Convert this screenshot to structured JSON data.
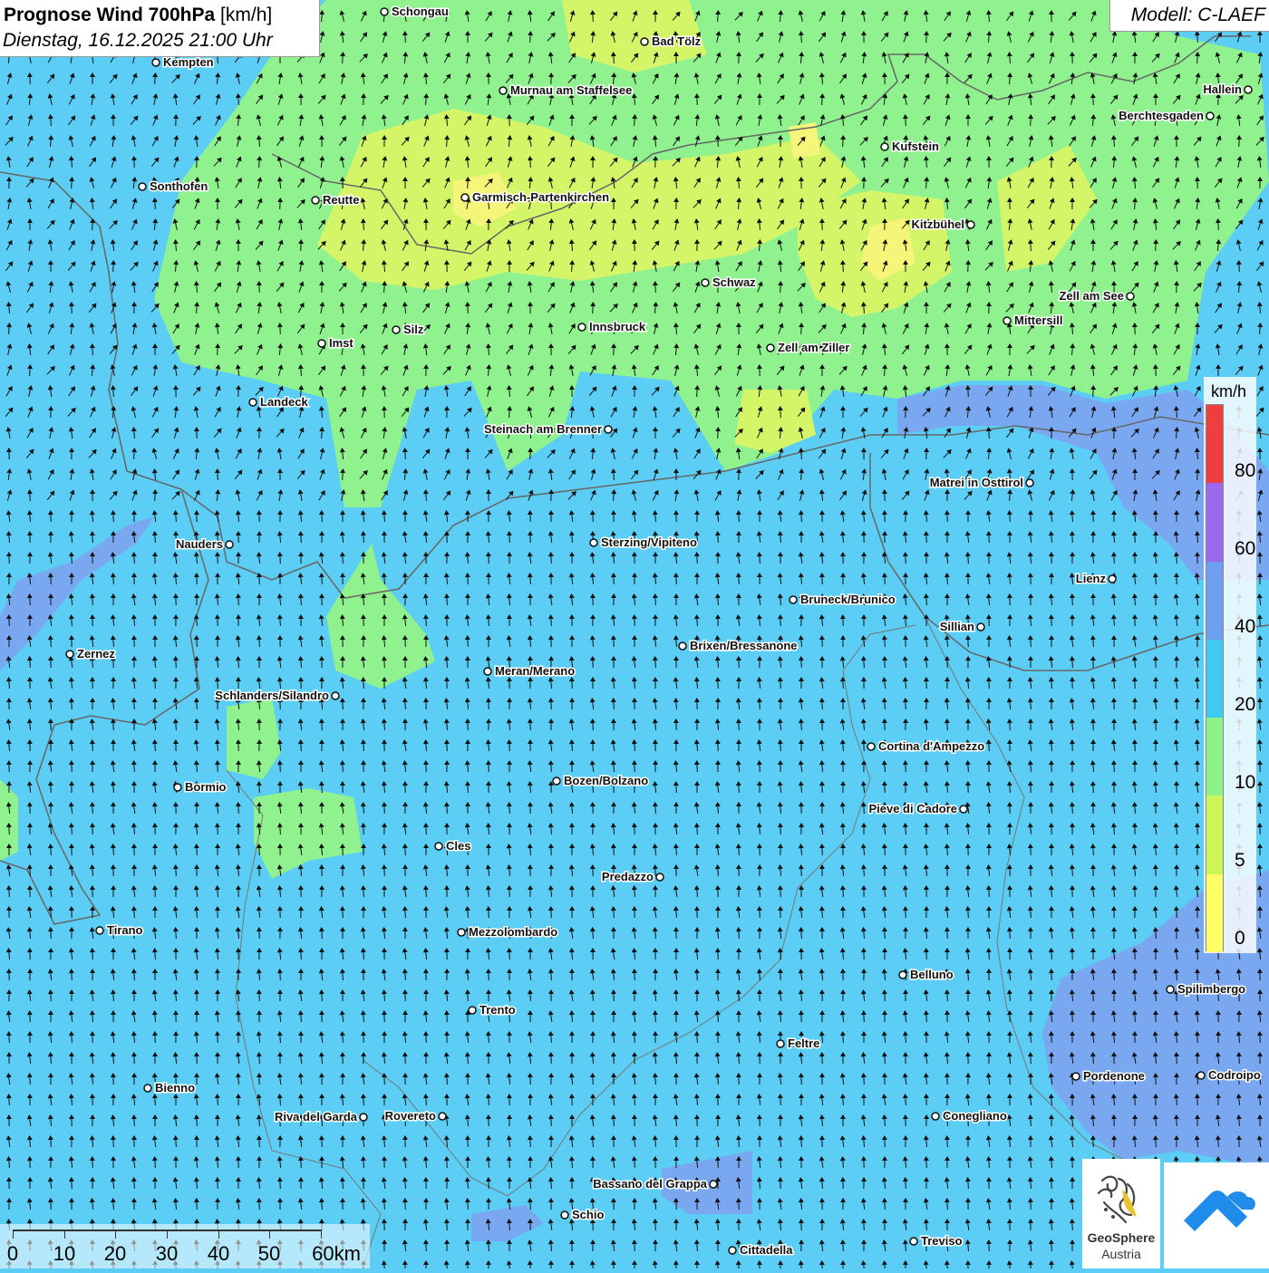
{
  "header": {
    "title_main": "Prognose Wind 700hPa",
    "title_unit": "[km/h]",
    "datetime": "Dienstag, 16.12.2025 21:00 Uhr",
    "model": "Modell: C-LAEF"
  },
  "legend": {
    "unit": "km/h",
    "ticks": [
      "0",
      "5",
      "10",
      "20",
      "40",
      "60",
      "80"
    ],
    "colors": [
      "#ffff66",
      "#ccf55a",
      "#8cf28a",
      "#3fcaf2",
      "#6e9ef0",
      "#9b68ee",
      "#ee3e3e"
    ]
  },
  "scale": {
    "labels": [
      "0",
      "10",
      "20",
      "30",
      "40",
      "50",
      "60km"
    ]
  },
  "logos": {
    "geosphere_line1": "GeoSphere",
    "geosphere_line2": "Austria"
  },
  "icons": [
    "wind-arrow-icon",
    "geosphere-logo-icon",
    "app-logo-icon"
  ],
  "cities": [
    {
      "name": "Schongau"
    },
    {
      "name": "Bad Tölz"
    },
    {
      "name": "Kempten"
    },
    {
      "name": "Murnau am Staffelsee"
    },
    {
      "name": "Hallein"
    },
    {
      "name": "Berchtesgaden"
    },
    {
      "name": "Kufstein"
    },
    {
      "name": "Sonthofen"
    },
    {
      "name": "Reutte"
    },
    {
      "name": "Garmisch-Partenkirchen"
    },
    {
      "name": "Kitzbühel"
    },
    {
      "name": "Schwaz"
    },
    {
      "name": "Zell am See"
    },
    {
      "name": "Mittersill"
    },
    {
      "name": "Imst"
    },
    {
      "name": "Silz"
    },
    {
      "name": "Innsbruck"
    },
    {
      "name": "Zell am Ziller"
    },
    {
      "name": "Landeck"
    },
    {
      "name": "Steinach am Brenner"
    },
    {
      "name": "Matrei in Osttirol"
    },
    {
      "name": "Nauders"
    },
    {
      "name": "Sterzing/Vipiteno"
    },
    {
      "name": "Lienz"
    },
    {
      "name": "Bruneck/Brunico"
    },
    {
      "name": "Sillian"
    },
    {
      "name": "Brixen/Bressanone"
    },
    {
      "name": "Zernez"
    },
    {
      "name": "Meran/Merano"
    },
    {
      "name": "Schlanders/Silandro"
    },
    {
      "name": "Cortina d'Ampezzo"
    },
    {
      "name": "Bozen/Bolzano"
    },
    {
      "name": "Bormio"
    },
    {
      "name": "Pieve di Cadore"
    },
    {
      "name": "Cles"
    },
    {
      "name": "Predazzo"
    },
    {
      "name": "Tirano"
    },
    {
      "name": "Mezzolombardo"
    },
    {
      "name": "Belluno"
    },
    {
      "name": "Spilimbergo"
    },
    {
      "name": "Trento"
    },
    {
      "name": "Feltre"
    },
    {
      "name": "Pordenone"
    },
    {
      "name": "Codroipo"
    },
    {
      "name": "Bienno"
    },
    {
      "name": "Riva del Garda"
    },
    {
      "name": "Rovereto"
    },
    {
      "name": "Conegliano"
    },
    {
      "name": "Bassano del Grappa"
    },
    {
      "name": "Schio"
    },
    {
      "name": "Treviso"
    },
    {
      "name": "Cittadella"
    }
  ]
}
